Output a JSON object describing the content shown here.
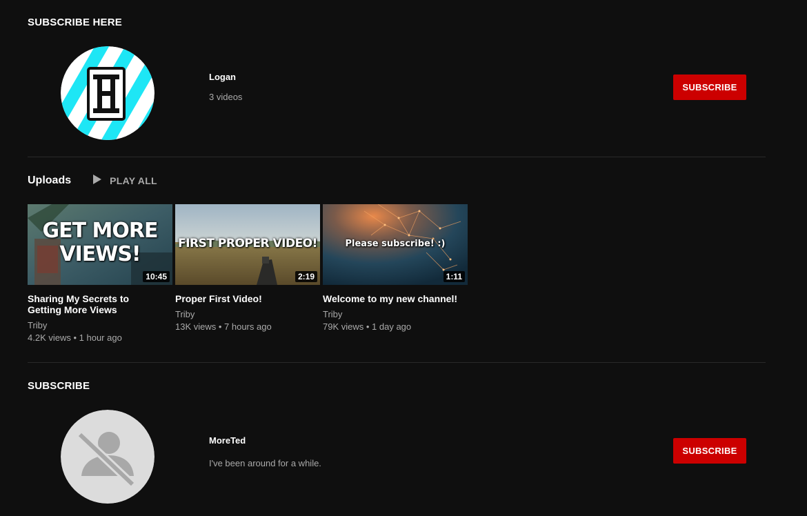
{
  "sections": [
    {
      "title": "SUBSCRIBE HERE",
      "channel": {
        "name": "Logan",
        "meta": "3 videos",
        "avatar_icon": "striped-logo-avatar"
      },
      "subscribe_label": "SUBSCRIBE"
    },
    {
      "title": "SUBSCRIBE",
      "channel": {
        "name": "MoreTed",
        "meta": "I've been around for a while.",
        "avatar_icon": "default-user-avatar"
      },
      "subscribe_label": "SUBSCRIBE"
    }
  ],
  "uploads": {
    "title": "Uploads",
    "play_all_label": "PLAY ALL",
    "play_icon": "play-icon",
    "videos": [
      {
        "thumb_text": "GET MORE VIEWS!",
        "duration": "10:45",
        "title": "Sharing My Secrets to Getting More Views",
        "author": "Triby",
        "stats": "4.2K views • 1 hour ago"
      },
      {
        "thumb_text": "FIRST PROPER VIDEO!",
        "duration": "2:19",
        "title": "Proper First Video!",
        "author": "Triby",
        "stats": "13K views • 7 hours ago"
      },
      {
        "thumb_text": "Please subscribe! :)",
        "duration": "1:11",
        "title": "Welcome to my new channel!",
        "author": "Triby",
        "stats": "79K views • 1 day ago"
      }
    ]
  },
  "colors": {
    "background": "#0f0f0f",
    "subscribe_red": "#cc0000",
    "secondary_text": "#aaaaaa",
    "divider": "#2a2a2a",
    "logo_cyan": "#1ee6f5"
  }
}
